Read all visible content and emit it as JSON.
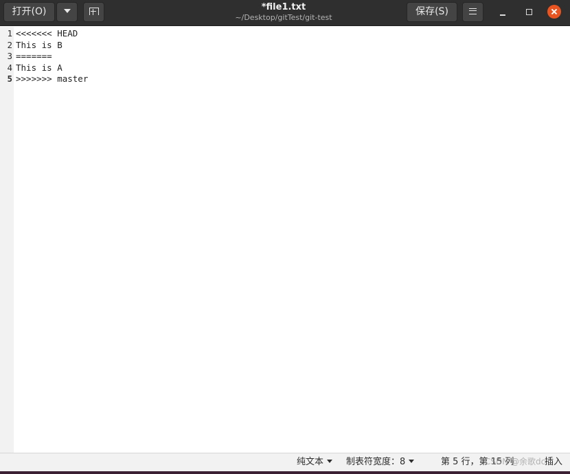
{
  "header": {
    "open_label": "打开(O)",
    "save_label": "保存(S)",
    "title": "*file1.txt",
    "subtitle": "~/Desktop/gitTest/git-test",
    "icons": {
      "dropdown": "chevron-down-icon",
      "new_tab": "new-tab-icon",
      "menu": "hamburger-menu-icon",
      "minimize": "minimize-icon",
      "maximize": "maximize-icon",
      "close": "close-icon"
    },
    "colors": {
      "close_accent": "#e95420",
      "header_bg": "#2f2f2f"
    }
  },
  "editor": {
    "current_line": 5,
    "lines": [
      {
        "num": "1",
        "text": "<<<<<<< HEAD"
      },
      {
        "num": "2",
        "text": "This is B"
      },
      {
        "num": "3",
        "text": "======="
      },
      {
        "num": "4",
        "text": "This is A"
      },
      {
        "num": "5",
        "text": ">>>>>>> master"
      }
    ]
  },
  "statusbar": {
    "language": "纯文本",
    "tab_width": "制表符宽度：8",
    "position": "第 5 行，第 15 列",
    "mode": "插入",
    "watermark": "CSDN @余歌dc"
  }
}
